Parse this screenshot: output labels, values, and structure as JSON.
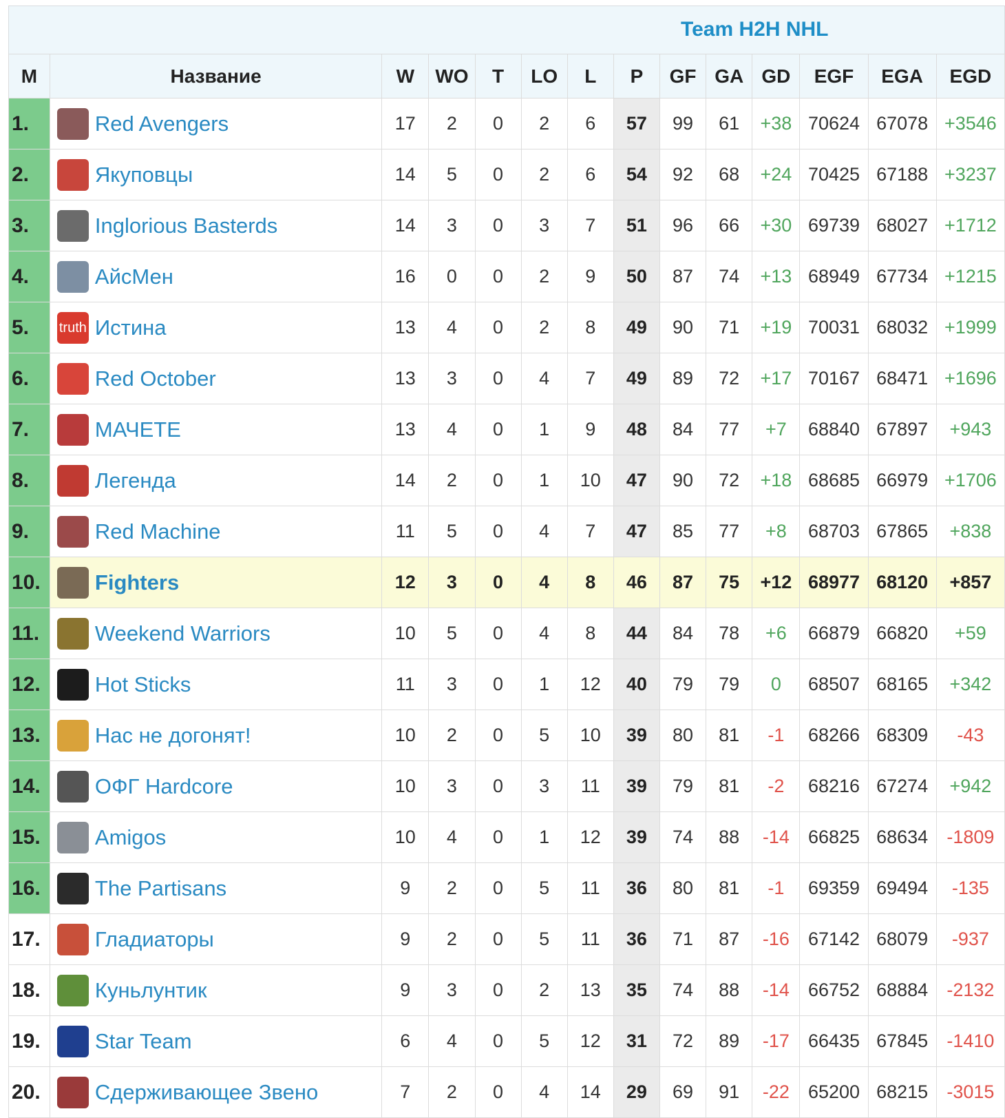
{
  "title": "Team H2H NHL",
  "columns": [
    "М",
    "Название",
    "W",
    "WO",
    "T",
    "LO",
    "L",
    "P",
    "GF",
    "GA",
    "GD",
    "EGF",
    "EGA",
    "EGD"
  ],
  "highlight_row": 9,
  "qualified_count": 16,
  "colors": {
    "qualified": "#7ccb8c",
    "link": "#2a8ac2",
    "positive": "#4fa55c",
    "negative": "#e0524a",
    "highlight": "#fbfbd8"
  },
  "rows": [
    {
      "rank": "1.",
      "team": "Red Avengers",
      "logo_color": "#8a5a5a",
      "w": "17",
      "wo": "2",
      "t": "0",
      "lo": "2",
      "l": "6",
      "p": "57",
      "gf": "99",
      "ga": "61",
      "gd": "+38",
      "egf": "70624",
      "ega": "67078",
      "egd": "+3546"
    },
    {
      "rank": "2.",
      "team": "Якуповцы",
      "logo_color": "#c8463c",
      "w": "14",
      "wo": "5",
      "t": "0",
      "lo": "2",
      "l": "6",
      "p": "54",
      "gf": "92",
      "ga": "68",
      "gd": "+24",
      "egf": "70425",
      "ega": "67188",
      "egd": "+3237"
    },
    {
      "rank": "3.",
      "team": "Inglorious Basterds",
      "logo_color": "#6b6b6b",
      "w": "14",
      "wo": "3",
      "t": "0",
      "lo": "3",
      "l": "7",
      "p": "51",
      "gf": "96",
      "ga": "66",
      "gd": "+30",
      "egf": "69739",
      "ega": "68027",
      "egd": "+1712"
    },
    {
      "rank": "4.",
      "team": "АйсМен",
      "logo_color": "#7d8fa3",
      "w": "16",
      "wo": "0",
      "t": "0",
      "lo": "2",
      "l": "9",
      "p": "50",
      "gf": "87",
      "ga": "74",
      "gd": "+13",
      "egf": "68949",
      "ega": "67734",
      "egd": "+1215"
    },
    {
      "rank": "5.",
      "team": "Истина",
      "logo_color": "#d93a2e",
      "logo_text": "truth",
      "w": "13",
      "wo": "4",
      "t": "0",
      "lo": "2",
      "l": "8",
      "p": "49",
      "gf": "90",
      "ga": "71",
      "gd": "+19",
      "egf": "70031",
      "ega": "68032",
      "egd": "+1999"
    },
    {
      "rank": "6.",
      "team": "Red October",
      "logo_color": "#d8453a",
      "w": "13",
      "wo": "3",
      "t": "0",
      "lo": "4",
      "l": "7",
      "p": "49",
      "gf": "89",
      "ga": "72",
      "gd": "+17",
      "egf": "70167",
      "ega": "68471",
      "egd": "+1696"
    },
    {
      "rank": "7.",
      "team": "МАЧЕТЕ",
      "logo_color": "#b83b3b",
      "w": "13",
      "wo": "4",
      "t": "0",
      "lo": "1",
      "l": "9",
      "p": "48",
      "gf": "84",
      "ga": "77",
      "gd": "+7",
      "egf": "68840",
      "ega": "67897",
      "egd": "+943"
    },
    {
      "rank": "8.",
      "team": "Легенда",
      "logo_color": "#c03a32",
      "w": "14",
      "wo": "2",
      "t": "0",
      "lo": "1",
      "l": "10",
      "p": "47",
      "gf": "90",
      "ga": "72",
      "gd": "+18",
      "egf": "68685",
      "ega": "66979",
      "egd": "+1706"
    },
    {
      "rank": "9.",
      "team": "Red Machine",
      "logo_color": "#9b4a4a",
      "w": "11",
      "wo": "5",
      "t": "0",
      "lo": "4",
      "l": "7",
      "p": "47",
      "gf": "85",
      "ga": "77",
      "gd": "+8",
      "egf": "68703",
      "ega": "67865",
      "egd": "+838"
    },
    {
      "rank": "10.",
      "team": "Fighters",
      "logo_color": "#7a6a55",
      "w": "12",
      "wo": "3",
      "t": "0",
      "lo": "4",
      "l": "8",
      "p": "46",
      "gf": "87",
      "ga": "75",
      "gd": "+12",
      "egf": "68977",
      "ega": "68120",
      "egd": "+857"
    },
    {
      "rank": "11.",
      "team": "Weekend Warriors",
      "logo_color": "#8a7430",
      "w": "10",
      "wo": "5",
      "t": "0",
      "lo": "4",
      "l": "8",
      "p": "44",
      "gf": "84",
      "ga": "78",
      "gd": "+6",
      "egf": "66879",
      "ega": "66820",
      "egd": "+59"
    },
    {
      "rank": "12.",
      "team": "Hot Sticks",
      "logo_color": "#1c1c1c",
      "w": "11",
      "wo": "3",
      "t": "0",
      "lo": "1",
      "l": "12",
      "p": "40",
      "gf": "79",
      "ga": "79",
      "gd": "0",
      "egf": "68507",
      "ega": "68165",
      "egd": "+342"
    },
    {
      "rank": "13.",
      "team": "Нас не догонят!",
      "logo_color": "#d9a23a",
      "w": "10",
      "wo": "2",
      "t": "0",
      "lo": "5",
      "l": "10",
      "p": "39",
      "gf": "80",
      "ga": "81",
      "gd": "-1",
      "egf": "68266",
      "ega": "68309",
      "egd": "-43"
    },
    {
      "rank": "14.",
      "team": "ОФГ Hardcore",
      "logo_color": "#555555",
      "w": "10",
      "wo": "3",
      "t": "0",
      "lo": "3",
      "l": "11",
      "p": "39",
      "gf": "79",
      "ga": "81",
      "gd": "-2",
      "egf": "68216",
      "ega": "67274",
      "egd": "+942"
    },
    {
      "rank": "15.",
      "team": "Amigos",
      "logo_color": "#8a8f96",
      "w": "10",
      "wo": "4",
      "t": "0",
      "lo": "1",
      "l": "12",
      "p": "39",
      "gf": "74",
      "ga": "88",
      "gd": "-14",
      "egf": "66825",
      "ega": "68634",
      "egd": "-1809"
    },
    {
      "rank": "16.",
      "team": "The Partisans",
      "logo_color": "#2b2b2b",
      "w": "9",
      "wo": "2",
      "t": "0",
      "lo": "5",
      "l": "11",
      "p": "36",
      "gf": "80",
      "ga": "81",
      "gd": "-1",
      "egf": "69359",
      "ega": "69494",
      "egd": "-135"
    },
    {
      "rank": "17.",
      "team": "Гладиаторы",
      "logo_color": "#c8503a",
      "w": "9",
      "wo": "2",
      "t": "0",
      "lo": "5",
      "l": "11",
      "p": "36",
      "gf": "71",
      "ga": "87",
      "gd": "-16",
      "egf": "67142",
      "ega": "68079",
      "egd": "-937"
    },
    {
      "rank": "18.",
      "team": "Куньлунтик",
      "logo_color": "#5f8f3a",
      "w": "9",
      "wo": "3",
      "t": "0",
      "lo": "2",
      "l": "13",
      "p": "35",
      "gf": "74",
      "ga": "88",
      "gd": "-14",
      "egf": "66752",
      "ega": "68884",
      "egd": "-2132"
    },
    {
      "rank": "19.",
      "team": "Star Team",
      "logo_color": "#1f3f8f",
      "w": "6",
      "wo": "4",
      "t": "0",
      "lo": "5",
      "l": "12",
      "p": "31",
      "gf": "72",
      "ga": "89",
      "gd": "-17",
      "egf": "66435",
      "ega": "67845",
      "egd": "-1410"
    },
    {
      "rank": "20.",
      "team": "Сдерживающее Звено",
      "logo_color": "#9a3a3a",
      "w": "7",
      "wo": "2",
      "t": "0",
      "lo": "4",
      "l": "14",
      "p": "29",
      "gf": "69",
      "ga": "91",
      "gd": "-22",
      "egf": "65200",
      "ega": "68215",
      "egd": "-3015"
    }
  ]
}
